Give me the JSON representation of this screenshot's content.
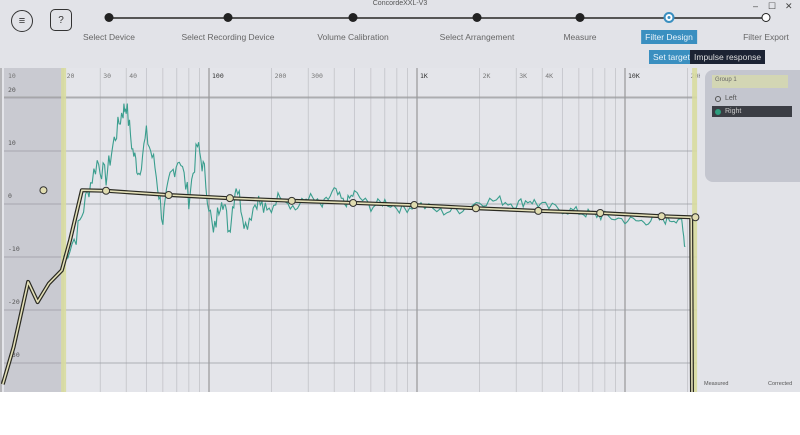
{
  "window": {
    "title": "ConcordeXXL-V3",
    "minimize": "–",
    "maximize": "☐",
    "close": "✕"
  },
  "toolbar": {
    "menu_icon": "≡",
    "help_icon": "?"
  },
  "steps": [
    {
      "label": "Select Device",
      "state": "done"
    },
    {
      "label": "Select Recording Device",
      "state": "done"
    },
    {
      "label": "Volume Calibration",
      "state": "done"
    },
    {
      "label": "Select Arrangement",
      "state": "done"
    },
    {
      "label": "Measure",
      "state": "done"
    },
    {
      "label": "Filter Design",
      "state": "active"
    },
    {
      "label": "Filter Export",
      "state": "todo"
    }
  ],
  "subtabs": [
    {
      "label": "Set target",
      "active": true
    },
    {
      "label": "Impulse response",
      "active": false
    }
  ],
  "panel": {
    "group": "Group 1",
    "channels": [
      {
        "label": "Left",
        "selected": false
      },
      {
        "label": "Right",
        "selected": true
      }
    ]
  },
  "legend": {
    "measured": "Measured",
    "corrected": "Corrected"
  },
  "colors": {
    "accent": "#3a8fc0",
    "measured": "#3a9e8e",
    "target": "#2a2a22",
    "target_inner": "#e4e0b8",
    "band": "#d8dba0"
  },
  "chart_data": {
    "type": "line",
    "x_scale": "log",
    "xlim": [
      10,
      20000
    ],
    "ylim": [
      -35,
      20
    ],
    "x_ticks": [
      {
        "v": 10,
        "label": "10"
      },
      {
        "v": 20,
        "label": "20"
      },
      {
        "v": 30,
        "label": "30"
      },
      {
        "v": 40,
        "label": "40"
      },
      {
        "v": 100,
        "label": "100"
      },
      {
        "v": 200,
        "label": "200"
      },
      {
        "v": 300,
        "label": "300"
      },
      {
        "v": 1000,
        "label": "1K"
      },
      {
        "v": 2000,
        "label": "2K"
      },
      {
        "v": 3000,
        "label": "3K"
      },
      {
        "v": 4000,
        "label": "4K"
      },
      {
        "v": 10000,
        "label": "10K"
      },
      {
        "v": 20000,
        "label": "20K"
      }
    ],
    "y_ticks": [
      {
        "v": 20,
        "label": "20"
      },
      {
        "v": 10,
        "label": "10"
      },
      {
        "v": 0,
        "label": "0"
      },
      {
        "v": -10,
        "label": "-10"
      },
      {
        "v": -20,
        "label": "-20"
      },
      {
        "v": -30,
        "label": "-30"
      }
    ],
    "band": [
      20,
      20000
    ],
    "target_handles": [
      [
        16,
        2.6
      ],
      [
        32,
        2.5
      ],
      [
        64,
        1.7
      ],
      [
        126,
        1.1
      ],
      [
        250,
        0.6
      ],
      [
        493,
        0.2
      ],
      [
        970,
        -0.2
      ],
      [
        1920,
        -0.8
      ],
      [
        3830,
        -1.3
      ],
      [
        7600,
        -1.7
      ],
      [
        15000,
        -2.3
      ],
      [
        21800,
        -2.5
      ]
    ],
    "target_curve": [
      [
        10.2,
        -34
      ],
      [
        11.5,
        -27
      ],
      [
        13.5,
        -14.7
      ],
      [
        15,
        -18.5
      ],
      [
        17,
        -15
      ],
      [
        19.6,
        -12.5
      ],
      [
        21.5,
        -6.8
      ],
      [
        24.5,
        2.6
      ],
      [
        32,
        2.5
      ],
      [
        64,
        1.7
      ],
      [
        126,
        1.1
      ],
      [
        250,
        0.6
      ],
      [
        493,
        0.2
      ],
      [
        970,
        -0.2
      ],
      [
        1920,
        -0.8
      ],
      [
        3830,
        -1.3
      ],
      [
        7600,
        -1.7
      ],
      [
        15000,
        -2.3
      ],
      [
        20800,
        -2.5
      ],
      [
        21000,
        -36
      ]
    ],
    "series": [
      {
        "name": "Measured",
        "points": [
          [
            20,
            -10
          ],
          [
            23,
            -6
          ],
          [
            26,
            2
          ],
          [
            29,
            8
          ],
          [
            32,
            5
          ],
          [
            35,
            12
          ],
          [
            38,
            17
          ],
          [
            40,
            18.7
          ],
          [
            43,
            10
          ],
          [
            46,
            6
          ],
          [
            50,
            13
          ],
          [
            55,
            7
          ],
          [
            60,
            -3
          ],
          [
            65,
            5
          ],
          [
            72,
            9
          ],
          [
            80,
            1
          ],
          [
            88,
            11
          ],
          [
            95,
            6
          ],
          [
            105,
            -6
          ],
          [
            115,
            2
          ],
          [
            125,
            -5
          ],
          [
            135,
            4
          ],
          [
            150,
            -4
          ],
          [
            170,
            1
          ],
          [
            190,
            -2
          ],
          [
            220,
            2
          ],
          [
            260,
            -1
          ],
          [
            300,
            1.5
          ],
          [
            350,
            -0.5
          ],
          [
            400,
            2.5
          ],
          [
            450,
            0
          ],
          [
            500,
            2
          ],
          [
            600,
            -0.5
          ],
          [
            700,
            0.5
          ],
          [
            850,
            -1
          ],
          [
            1000,
            0
          ],
          [
            1300,
            -1.5
          ],
          [
            1600,
            -1
          ],
          [
            2000,
            0.5
          ],
          [
            2500,
            0.7
          ],
          [
            3000,
            0
          ],
          [
            3500,
            0.8
          ],
          [
            4000,
            -0.5
          ],
          [
            5000,
            -1
          ],
          [
            6000,
            -1.5
          ],
          [
            7000,
            -2
          ],
          [
            8000,
            -2.3
          ],
          [
            10000,
            -3
          ],
          [
            12000,
            -3.3
          ],
          [
            14000,
            -2.8
          ],
          [
            16000,
            -3
          ],
          [
            18500,
            -2.5
          ],
          [
            19500,
            -8
          ]
        ]
      }
    ]
  }
}
